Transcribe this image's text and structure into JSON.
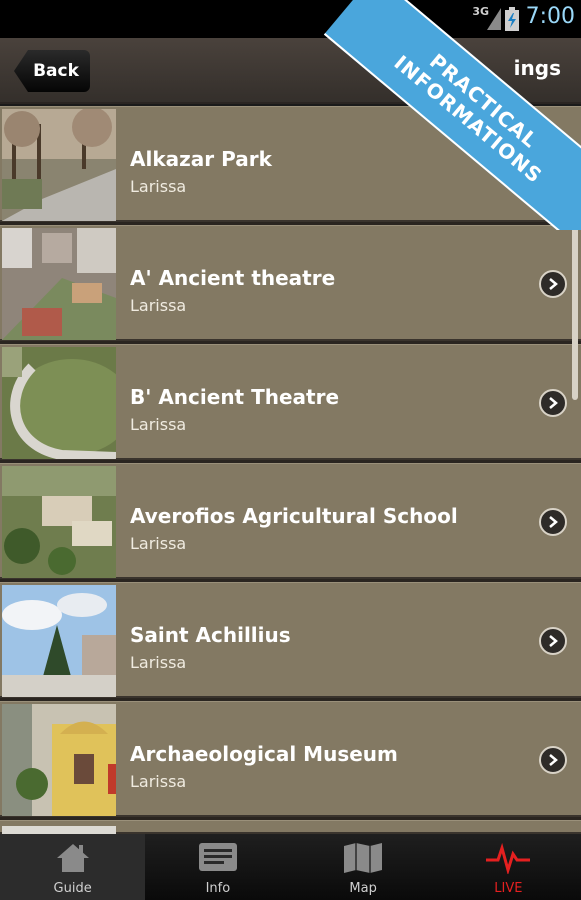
{
  "status_bar": {
    "network": "3G",
    "time": "7:00"
  },
  "header": {
    "back_label": "Back",
    "title_visible": "ings"
  },
  "ribbon": {
    "line1": "PRACTICAL",
    "line2": "INFORMATIONS"
  },
  "list": {
    "items": [
      {
        "title": "Alkazar Park",
        "subtitle": "Larissa",
        "has_chevron": false
      },
      {
        "title": "A' Ancient theatre",
        "subtitle": "Larissa",
        "has_chevron": true
      },
      {
        "title": "B' Ancient Theatre",
        "subtitle": "Larissa",
        "has_chevron": true
      },
      {
        "title": "Averofios Agricultural School",
        "subtitle": "Larissa",
        "has_chevron": true
      },
      {
        "title": "Saint Achillius",
        "subtitle": "Larissa",
        "has_chevron": true
      },
      {
        "title": "Archaeological Museum",
        "subtitle": "Larissa",
        "has_chevron": true
      }
    ]
  },
  "tabbar": {
    "tabs": [
      {
        "label": "Guide",
        "icon": "home-icon",
        "active": true
      },
      {
        "label": "Info",
        "icon": "info-icon",
        "active": false
      },
      {
        "label": "Map",
        "icon": "map-icon",
        "active": false
      },
      {
        "label": "LIVE",
        "icon": "live-heartbeat-icon",
        "active": false
      }
    ]
  },
  "colors": {
    "row_bg": "#837963",
    "ribbon": "#4aa6dc",
    "live_accent": "#e52020",
    "time": "#9ad8f8"
  }
}
